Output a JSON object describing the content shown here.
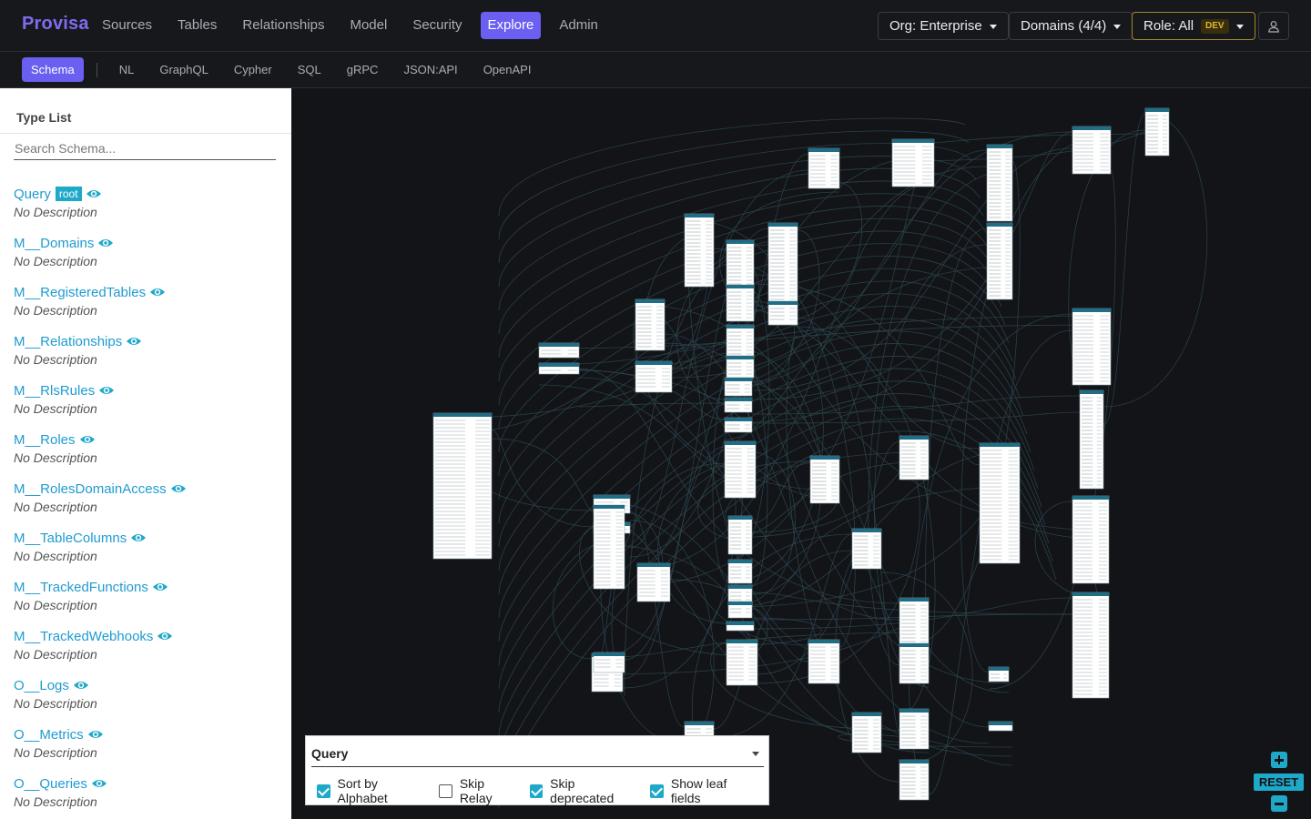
{
  "brand": "Provisa",
  "nav": [
    "Sources",
    "Tables",
    "Relationships",
    "Model",
    "Security",
    "Explore",
    "Admin"
  ],
  "nav_active": "Explore",
  "org_selector": "Org: Enterprise",
  "domains_selector": "Domains (4/4)",
  "role_selector": "Role: All",
  "role_badge": "DEV",
  "subnav": [
    "Schema",
    "NL",
    "GraphQL",
    "Cypher",
    "SQL",
    "gRPC",
    "JSON:API",
    "OpenAPI"
  ],
  "subnav_active": "Schema",
  "sidebar": {
    "title": "Type List",
    "search_placeholder": "Search Schema...",
    "root_tag": "root",
    "types": [
      {
        "name": "Query",
        "description": "No Description",
        "root": true
      },
      {
        "name": "M__Domains",
        "description": "No Description"
      },
      {
        "name": "M__RegisteredTables",
        "description": "No Description"
      },
      {
        "name": "M__Relationships",
        "description": "No Description"
      },
      {
        "name": "M__RlsRules",
        "description": "No Description"
      },
      {
        "name": "M__Roles",
        "description": "No Description"
      },
      {
        "name": "M__RolesDomainAccess",
        "description": "No Description"
      },
      {
        "name": "M__TableColumns",
        "description": "No Description"
      },
      {
        "name": "M__TrackedFunctions",
        "description": "No Description"
      },
      {
        "name": "M__TrackedWebhooks",
        "description": "No Description"
      },
      {
        "name": "O__Logs",
        "description": "No Description"
      },
      {
        "name": "O__Metrics",
        "description": "No Description"
      },
      {
        "name": "O__Queries",
        "description": "No Description"
      }
    ]
  },
  "query_panel": {
    "title": "Query",
    "options": [
      {
        "label": "Sort by Alphabet",
        "checked": true
      },
      {
        "label": "Skip Relay",
        "checked": false
      },
      {
        "label": "Skip deprecated",
        "checked": true
      },
      {
        "label": "Show leaf fields",
        "checked": true
      }
    ]
  },
  "zoom": {
    "reset_label": "RESET"
  },
  "colors": {
    "accent": "#6a5ff0",
    "link": "#1f9bd1",
    "teal": "#1fa9c9",
    "dev_badge": "#e0b531"
  }
}
